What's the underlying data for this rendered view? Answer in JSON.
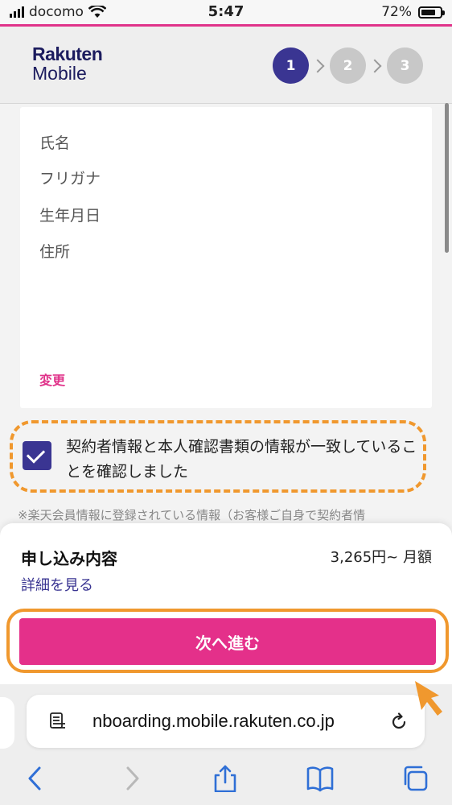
{
  "status_bar": {
    "carrier": "docomo",
    "time": "5:47",
    "battery": "72%"
  },
  "header": {
    "logo_line1": "Rakuten",
    "logo_line2": "Mobile",
    "steps": [
      {
        "label": "1",
        "active": true
      },
      {
        "label": "2",
        "active": false
      },
      {
        "label": "3",
        "active": false
      }
    ]
  },
  "card": {
    "fields": [
      "氏名",
      "フリガナ",
      "生年月日",
      "住所"
    ],
    "change_link": "変更"
  },
  "confirm": {
    "checked": true,
    "text": "契約者情報と本人確認書類の情報が一致していることを確認しました"
  },
  "note": "※楽天会員情報に登録されている情報（お客様ご自身で契約者情",
  "summary": {
    "title": "申し込み内容",
    "detail_link": "詳細を見る",
    "price": "3,265円~ 月額",
    "next_button": "次へ進む"
  },
  "browser": {
    "url": "nboarding.mobile.rakuten.co.jp",
    "accent_color": "#2f6fd6"
  }
}
